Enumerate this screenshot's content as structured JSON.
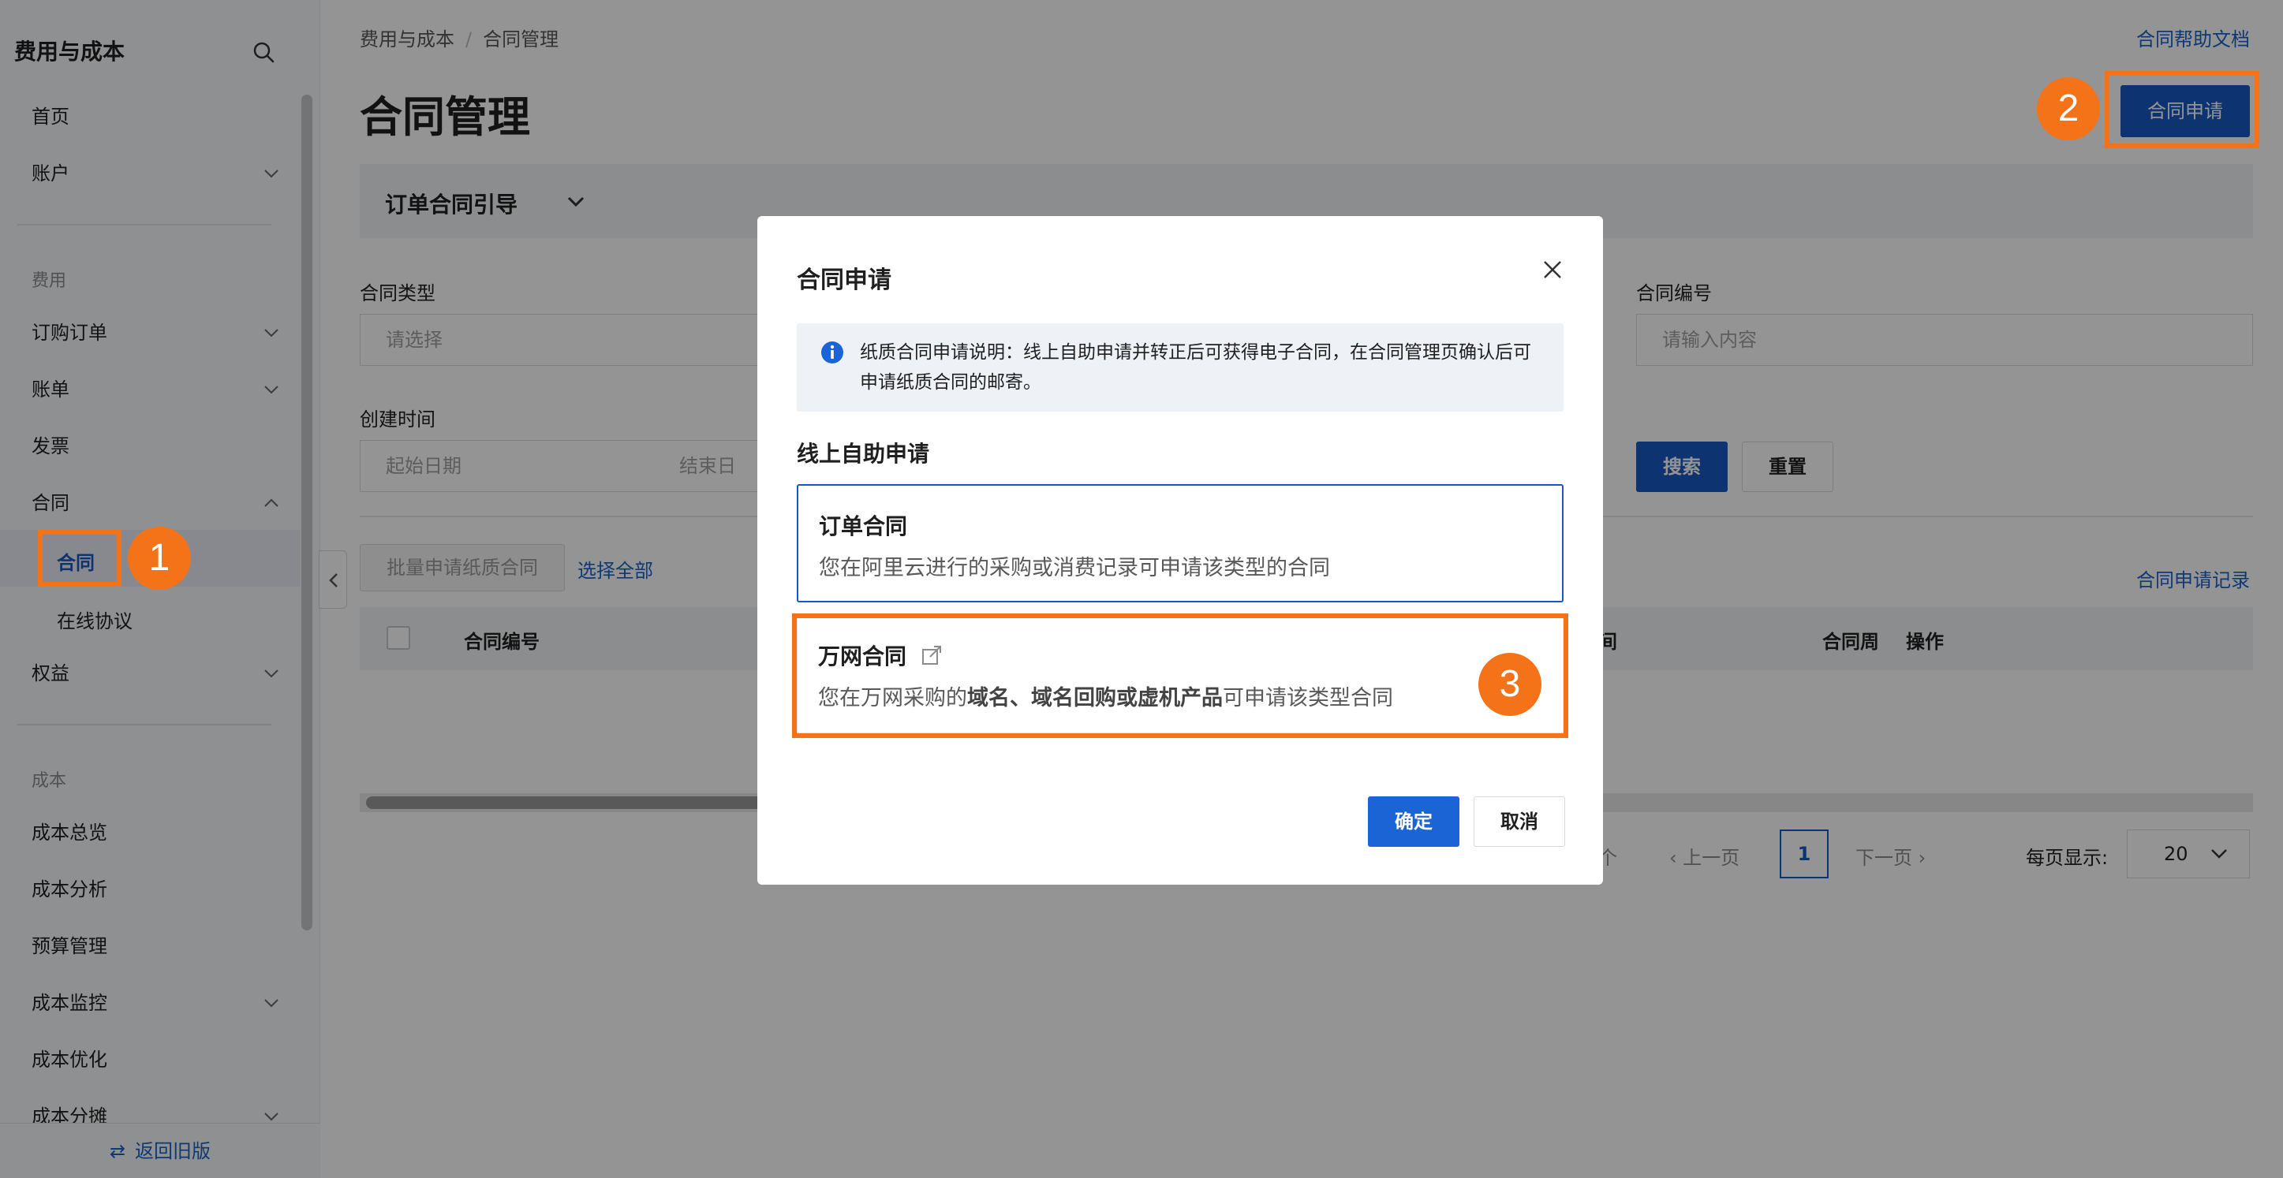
{
  "sidebar": {
    "title": "费用与成本",
    "items": {
      "home": "首页",
      "account": "账户",
      "group_fee": "费用",
      "orders": "订购订单",
      "bills": "账单",
      "invoice": "发票",
      "contract": "合同",
      "contract_sub": "合同",
      "online_agreement": "在线协议",
      "rights": "权益",
      "group_cost": "成本",
      "cost_overview": "成本总览",
      "cost_analysis": "成本分析",
      "budget": "预算管理",
      "cost_monitor": "成本监控",
      "cost_optimize": "成本优化",
      "cost_allocation": "成本分摊"
    },
    "footer": "返回旧版"
  },
  "header": {
    "breadcrumb": [
      "费用与成本",
      "合同管理"
    ],
    "help_link": "合同帮助文档",
    "title": "合同管理",
    "apply_button": "合同申请"
  },
  "guide": {
    "label": "订单合同引导"
  },
  "filters": {
    "contract_type_label": "合同类型",
    "contract_type_placeholder": "请选择",
    "contract_no_label": "合同编号",
    "contract_no_placeholder": "请输入内容",
    "created_label": "创建时间",
    "start_placeholder": "起始日期",
    "end_placeholder": "结束日",
    "search": "搜索",
    "reset": "重置"
  },
  "table": {
    "batch_button": "批量申请纸质合同",
    "select_all": "选择全部",
    "records_link": "合同申请记录",
    "col_no": "合同编号",
    "col_partial_1": "间",
    "col_partial_2": "合同周",
    "col_actions": "操作"
  },
  "pagination": {
    "count_suffix": "个",
    "prev": "上一页",
    "current": "1",
    "next": "下一页",
    "page_size_label": "每页显示:",
    "page_size": "20"
  },
  "modal": {
    "title": "合同申请",
    "notice": "纸质合同申请说明：线上自助申请并转正后可获得电子合同，在合同管理页确认后可申请纸质合同的邮寄。",
    "section": "线上自助申请",
    "card_order_title": "订单合同",
    "card_order_desc": "您在阿里云进行的采购或消费记录可申请该类型的合同",
    "card_wanwang_title": "万网合同",
    "card_wanwang_desc_prefix": "您在万网采购的",
    "card_wanwang_desc_bold": "域名、域名回购或虚机产品",
    "card_wanwang_desc_suffix": "可申请该类型合同",
    "ok": "确定",
    "cancel": "取消"
  },
  "callouts": {
    "step1": "1",
    "step2": "2",
    "step3": "3",
    "color": "#f47318"
  }
}
